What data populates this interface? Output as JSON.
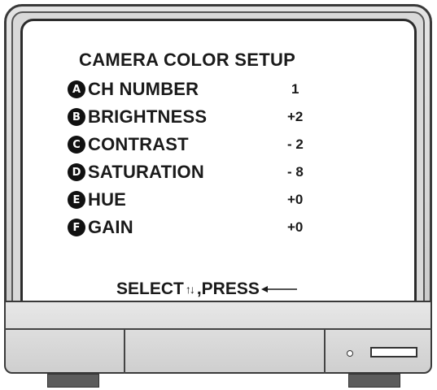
{
  "title": "CAMERA COLOR SETUP",
  "menu_items": [
    {
      "letter": "A",
      "label": "CH NUMBER",
      "value": "1"
    },
    {
      "letter": "B",
      "label": "BRIGHTNESS",
      "value": "+2"
    },
    {
      "letter": "C",
      "label": "CONTRAST",
      "value": "- 2"
    },
    {
      "letter": "D",
      "label": "SATURATION",
      "value": "- 8"
    },
    {
      "letter": "E",
      "label": "HUE",
      "value": "+0"
    },
    {
      "letter": "F",
      "label": "GAIN",
      "value": "+0"
    }
  ],
  "footer": {
    "select_label": "SELECT",
    "select_icon": "up-down-arrows-icon",
    "press_label": ",PRESS",
    "press_icon": "enter-arrow-icon"
  },
  "colors": {
    "text": "#1a1a1a",
    "bezel": "#d9d9d9"
  }
}
